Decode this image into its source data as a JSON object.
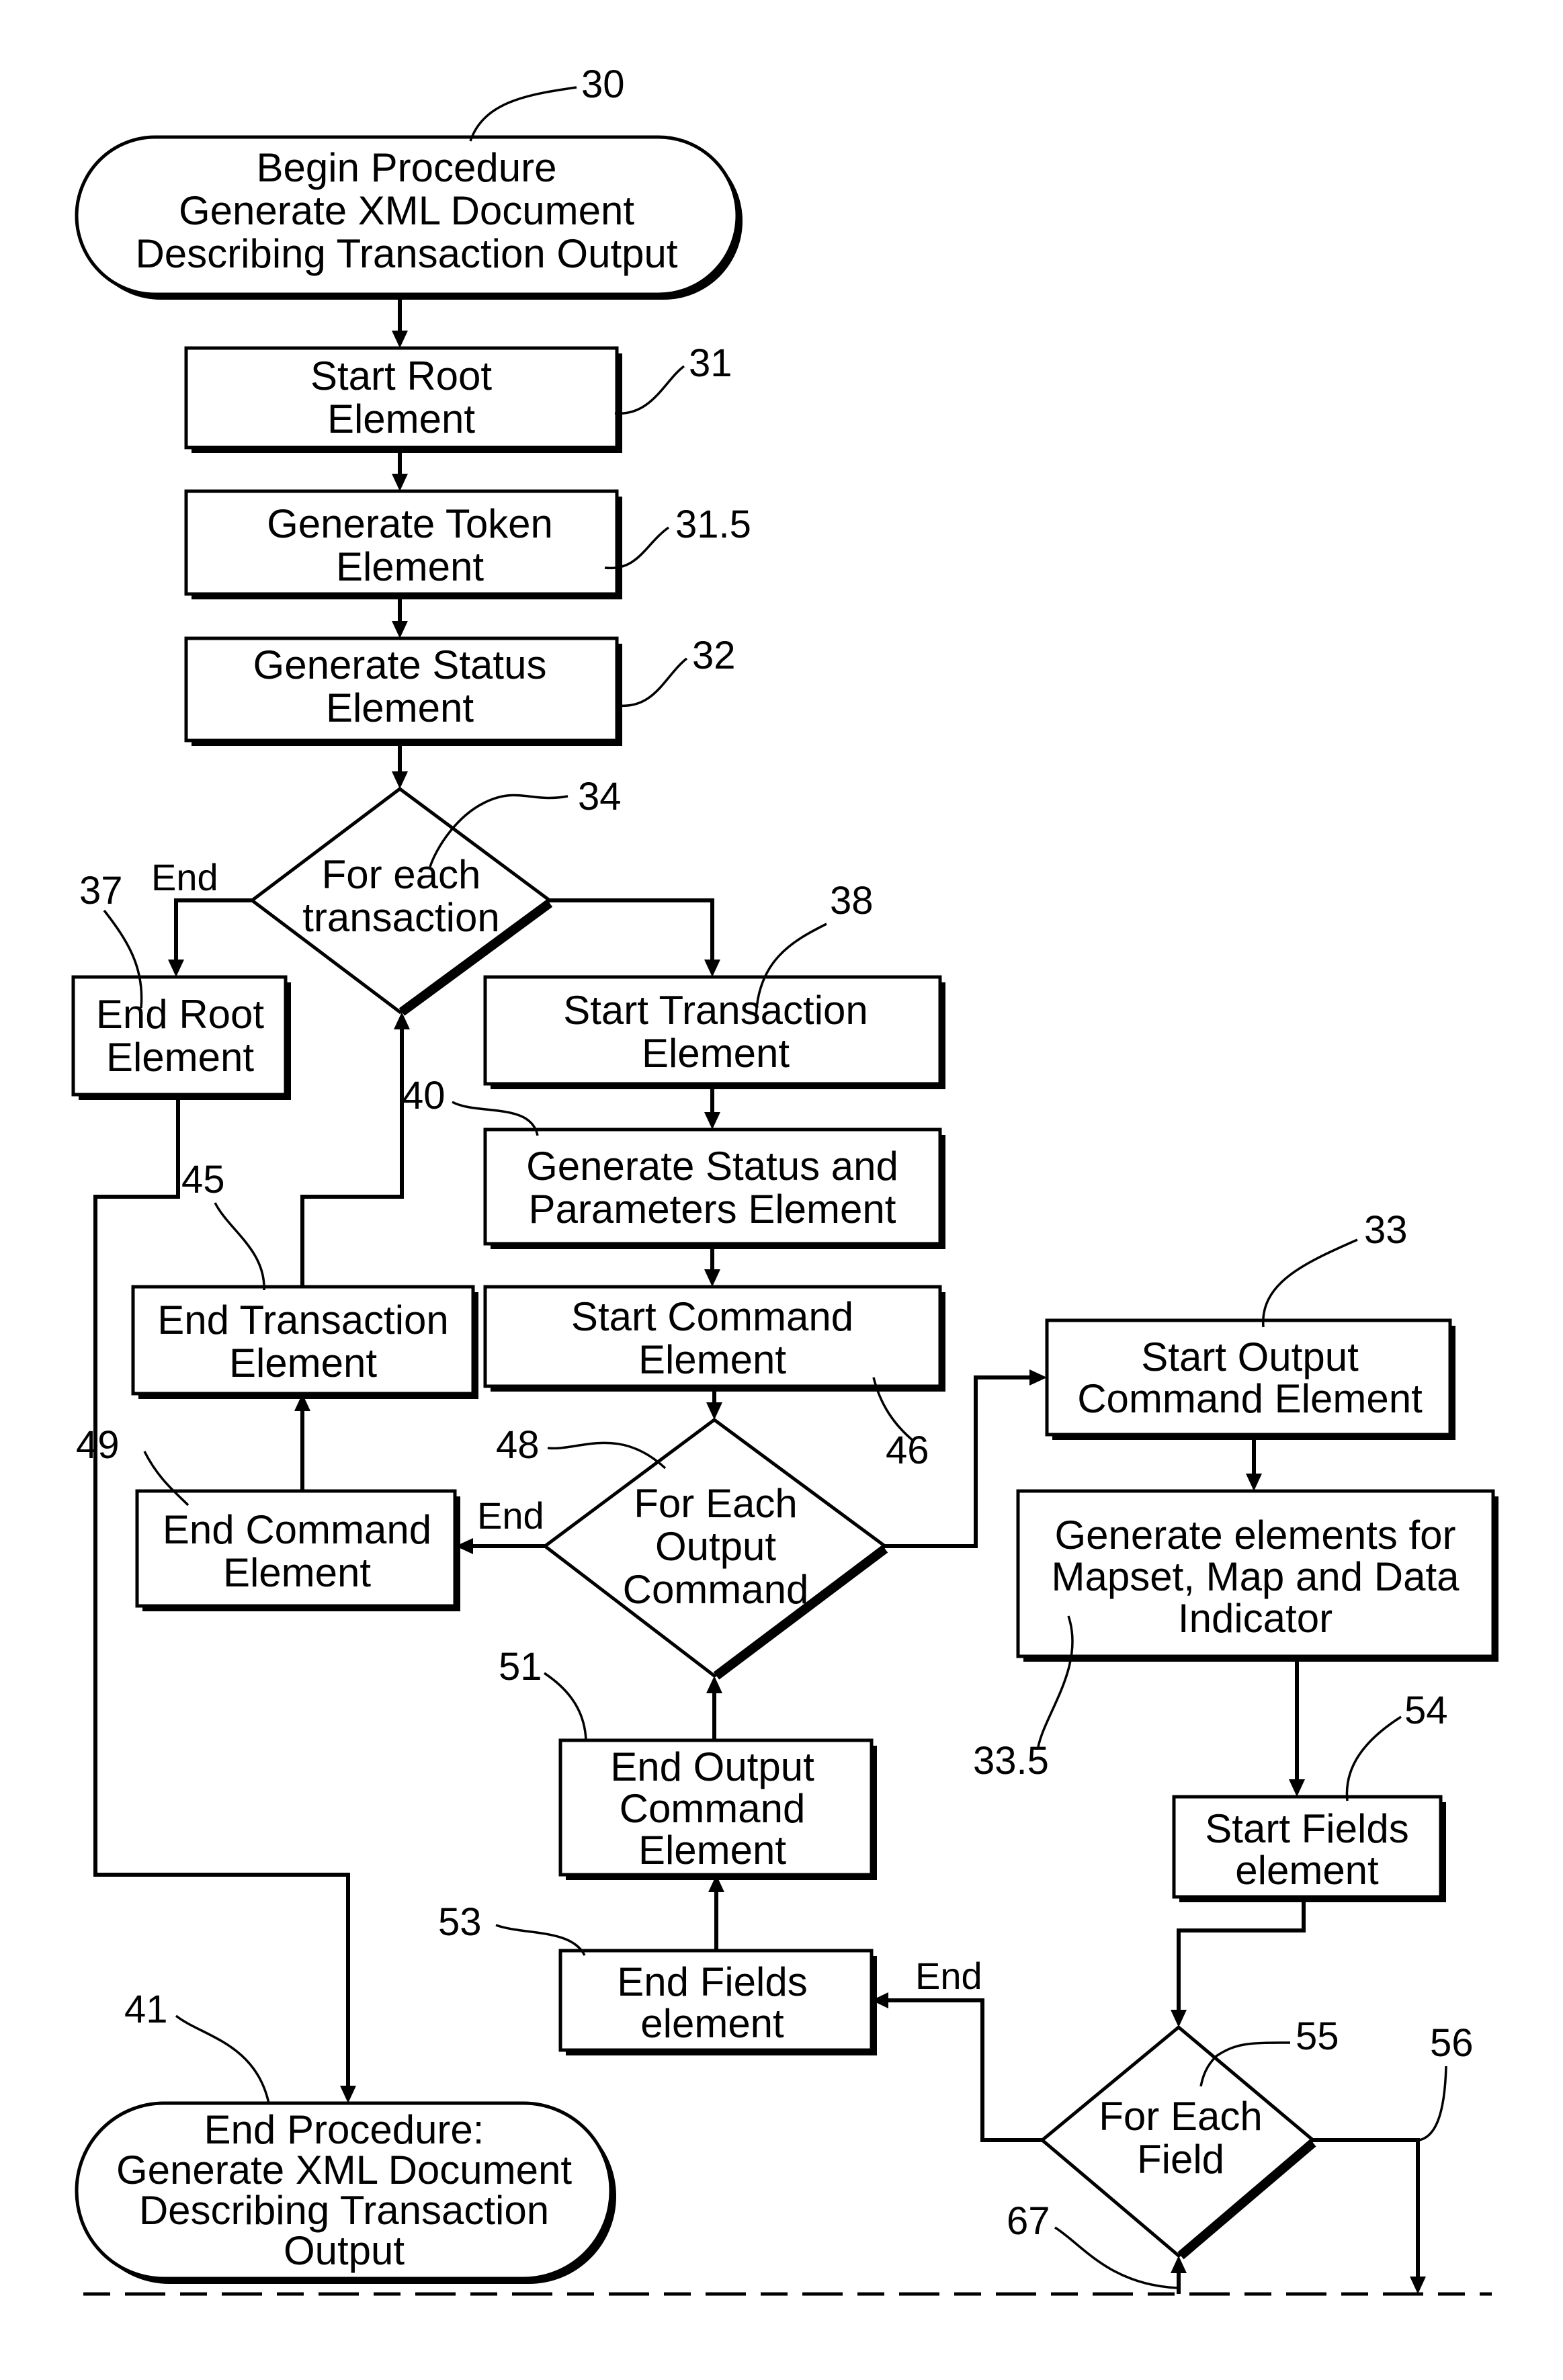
{
  "diagram": {
    "type": "flowchart",
    "nodes": {
      "begin": {
        "ref": "30",
        "shape": "terminator",
        "lines": [
          "Begin Procedure",
          "Generate XML Document",
          "Describing Transaction Output"
        ]
      },
      "start_root": {
        "ref": "31",
        "shape": "process",
        "lines": [
          "Start Root",
          "Element"
        ]
      },
      "gen_token": {
        "ref": "31.5",
        "shape": "process",
        "lines": [
          "Generate Token",
          "Element"
        ]
      },
      "gen_status": {
        "ref": "32",
        "shape": "process",
        "lines": [
          "Generate Status",
          "Element"
        ]
      },
      "for_each_txn": {
        "ref": "34",
        "shape": "decision",
        "lines": [
          "For each",
          "transaction"
        ]
      },
      "end_root": {
        "ref": "37",
        "shape": "process",
        "lines": [
          "End Root",
          "Element"
        ]
      },
      "start_txn": {
        "ref": "38",
        "shape": "process",
        "lines": [
          "Start Transaction",
          "Element"
        ]
      },
      "gen_status_params": {
        "ref": "40",
        "shape": "process",
        "lines": [
          "Generate Status and",
          "Parameters Element"
        ]
      },
      "end_txn": {
        "ref": "45",
        "shape": "process",
        "lines": [
          "End Transaction",
          "Element"
        ]
      },
      "start_cmd": {
        "ref": "46",
        "shape": "process",
        "lines": [
          "Start Command",
          "Element"
        ]
      },
      "for_each_out_cmd": {
        "ref": "48",
        "shape": "decision",
        "lines": [
          "For Each",
          "Output",
          "Command"
        ]
      },
      "end_cmd": {
        "ref": "49",
        "shape": "process",
        "lines": [
          "End Command",
          "Element"
        ]
      },
      "start_out_cmd": {
        "ref": "33",
        "shape": "process",
        "lines": [
          "Start Output",
          "Command Element"
        ]
      },
      "gen_elements": {
        "ref": "33.5",
        "shape": "process",
        "lines": [
          "Generate elements for",
          "Mapset, Map and Data",
          "Indicator"
        ]
      },
      "end_out_cmd": {
        "ref": "51",
        "shape": "process",
        "lines": [
          "End Output",
          "Command",
          "Element"
        ]
      },
      "start_fields": {
        "ref": "54",
        "shape": "process",
        "lines": [
          "Start Fields",
          "element"
        ]
      },
      "end_fields": {
        "ref": "53",
        "shape": "process",
        "lines": [
          "End Fields",
          "element"
        ]
      },
      "for_each_field": {
        "ref": "55",
        "shape": "decision",
        "lines": [
          "For Each",
          "Field"
        ]
      },
      "end": {
        "ref": "41",
        "shape": "terminator",
        "lines": [
          "End Procedure:",
          "Generate XML Document",
          "Describing Transaction",
          "Output"
        ]
      }
    },
    "branch_labels": {
      "txn_end": "End",
      "out_cmd_end": "End",
      "field_end": "End"
    },
    "edge_refs": {
      "field_loop_out": "56",
      "field_loop_in": "67"
    },
    "edges": [
      [
        "begin",
        "start_root"
      ],
      [
        "start_root",
        "gen_token"
      ],
      [
        "gen_token",
        "gen_status"
      ],
      [
        "gen_status",
        "for_each_txn"
      ],
      [
        "for_each_txn",
        "end_root",
        "End"
      ],
      [
        "for_each_txn",
        "start_txn"
      ],
      [
        "start_txn",
        "gen_status_params"
      ],
      [
        "gen_status_params",
        "start_cmd"
      ],
      [
        "start_cmd",
        "for_each_out_cmd"
      ],
      [
        "for_each_out_cmd",
        "end_cmd",
        "End"
      ],
      [
        "for_each_out_cmd",
        "start_out_cmd"
      ],
      [
        "start_out_cmd",
        "gen_elements"
      ],
      [
        "gen_elements",
        "start_fields"
      ],
      [
        "start_fields",
        "for_each_field"
      ],
      [
        "for_each_field",
        "end_fields",
        "End"
      ],
      [
        "end_fields",
        "end_out_cmd"
      ],
      [
        "end_out_cmd",
        "for_each_out_cmd"
      ],
      [
        "end_cmd",
        "end_txn"
      ],
      [
        "end_txn",
        "for_each_txn"
      ],
      [
        "end_root",
        "end"
      ]
    ]
  }
}
